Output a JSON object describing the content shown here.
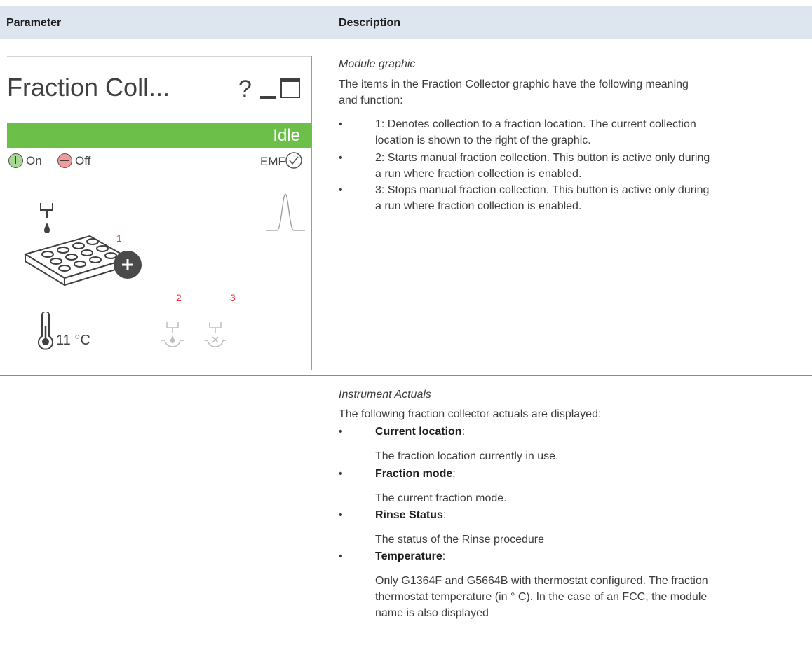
{
  "table": {
    "header_parameter": "Parameter",
    "header_description": "Description"
  },
  "module": {
    "title": "Fraction Coll...",
    "help": "?",
    "status": "Idle",
    "status_color": "#6cc04a",
    "on_label": "On",
    "off_label": "Off",
    "emf_label": "EMF",
    "temperature": "11 °C",
    "callouts": [
      "1",
      "2",
      "3"
    ],
    "icons": [
      "help-icon",
      "minimize-icon",
      "maximize-icon",
      "on-icon",
      "off-icon",
      "emf-check-icon",
      "peak-icon",
      "fraction-needle-icon",
      "fraction-plate-icon",
      "add-icon",
      "thermometer-icon",
      "start-collection-icon",
      "stop-collection-icon"
    ]
  },
  "graphic_section": {
    "heading": "Module graphic",
    "intro_line1": "The items in the Fraction Collector graphic have the following meaning",
    "intro_line2": "and function:",
    "items": [
      {
        "line1": "1: Denotes collection to a fraction location. The current collection",
        "line2": "location is shown to the right of the graphic."
      },
      {
        "line1": "2: Starts manual fraction collection. This button is active only during",
        "line2": "a run where fraction collection is enabled."
      },
      {
        "line1": "3: Stops manual fraction collection. This button is active only during",
        "line2": "a run where fraction collection is enabled."
      }
    ]
  },
  "actuals_section": {
    "heading": "Instrument Actuals",
    "intro": "The following fraction collector actuals are displayed:",
    "items": [
      {
        "term": "Current location",
        "desc1": "The fraction location currently in use."
      },
      {
        "term": "Fraction mode",
        "desc1": "The current fraction mode."
      },
      {
        "term": "Rinse Status",
        "desc1": "The status of the Rinse procedure"
      },
      {
        "term": "Temperature",
        "desc1": "Only G1364F and G5664B with thermostat configured. The fraction",
        "desc2": "thermostat temperature (in ° C). In the case of an FCC, the module",
        "desc3": "name is also displayed"
      }
    ]
  }
}
